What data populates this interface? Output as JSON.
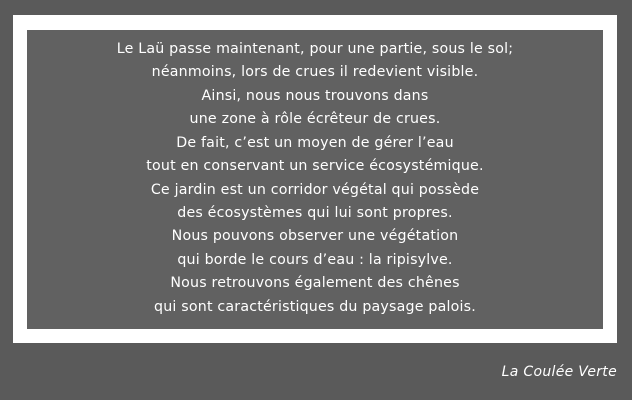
{
  "quote": {
    "lines": [
      "Le Laü passe maintenant, pour une partie, sous le sol;",
      "néanmoins, lors de crues il redevient visible.",
      "Ainsi, nous nous trouvons dans",
      "une zone à rôle écrêteur de crues.",
      "De fait, c’est un moyen de gérer l’eau",
      "tout en conservant un service écosystémique.",
      "Ce jardin est un corridor végétal qui possède",
      "des écosystèmes qui lui sont propres.",
      "Nous pouvons observer une végétation",
      "qui borde le cours d’eau : la ripisylve.",
      "Nous retrouvons également des chênes",
      "qui sont caractéristiques du paysage palois."
    ]
  },
  "caption": "La Coulée Verte",
  "colors": {
    "background": "#5a5a5a",
    "frame": "#ffffff",
    "panel": "#616161",
    "text": "#ffffff"
  }
}
